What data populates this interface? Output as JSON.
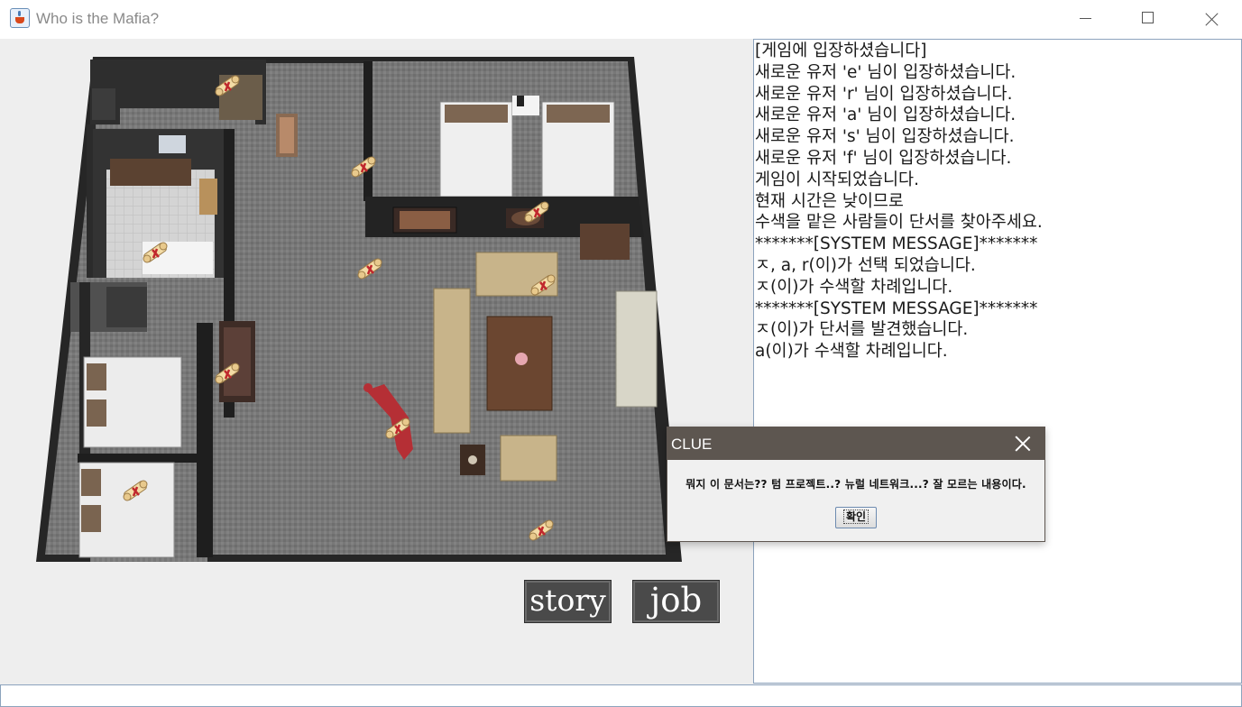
{
  "window": {
    "title": "Who is the Mafia?",
    "icon": "java-cup-icon",
    "controls": [
      "minimize-icon",
      "maximize-icon",
      "close-icon"
    ]
  },
  "map": {
    "clue_icon": "scroll-icon",
    "clue_count": 11
  },
  "buttons": {
    "story": "story",
    "job": "job"
  },
  "chat": {
    "lines": [
      "[게임에 입장하셨습니다]",
      "새로운 유저 'e' 님이 입장하셨습니다.",
      "새로운 유저 'r' 님이 입장하셨습니다.",
      "새로운 유저 'a' 님이 입장하셨습니다.",
      "새로운 유저 's' 님이 입장하셨습니다.",
      "새로운 유저 'f' 님이 입장하셨습니다.",
      "게임이 시작되었습니다.",
      "현재 시간은 낮이므로",
      "수색을 맡은 사람들이 단서를 찾아주세요.",
      "*******[SYSTEM MESSAGE]*******",
      "ㅈ, a, r(이)가 선택 되었습니다.",
      "ㅈ(이)가 수색할 차례입니다.",
      "*******[SYSTEM MESSAGE]*******",
      "ㅈ(이)가 단서를 발견했습니다.",
      "a(이)가 수색할 차례입니다."
    ]
  },
  "input": {
    "value": ""
  },
  "dialog": {
    "title": "CLUE",
    "message": "뭐지 이 문서는?? 텀 프로젝트..? 뉴럴 네트워크...? 잘 모르는 내용이다.",
    "ok_label": "확인"
  },
  "colors": {
    "dialog_header": "#5d5650",
    "button_bg": "#4a4a4a",
    "wall": "#2b2b2b",
    "carpet": "#7a7a7a"
  }
}
